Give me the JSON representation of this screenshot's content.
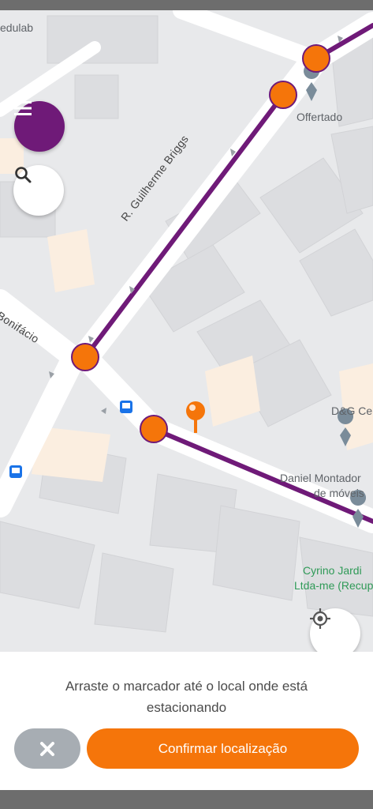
{
  "map": {
    "labels": {
      "edulab": "edulab",
      "offertado": "Offertado",
      "street_guilherme": "R. Guilherme Briggs",
      "street_bonifacio": "Bonifácio",
      "dg": "D&G Ce",
      "daniel_line1": "Daniel Montador",
      "daniel_line2": "de móveis",
      "cyrino_line1": "Cyrino Jardi",
      "cyrino_line2": "Ltda-me (Recupera"
    },
    "route_color": "#6f1a78",
    "node_color": "#f5750a",
    "marker_color": "#f5750a"
  },
  "buttons": {
    "menu_icon": "menu-icon",
    "search_icon": "search-icon",
    "locate_icon": "crosshair-icon",
    "cancel_icon": "close-icon",
    "confirm_label": "Confirmar localização"
  },
  "panel": {
    "instruction": "Arraste o marcador até o local onde está estacionando"
  }
}
